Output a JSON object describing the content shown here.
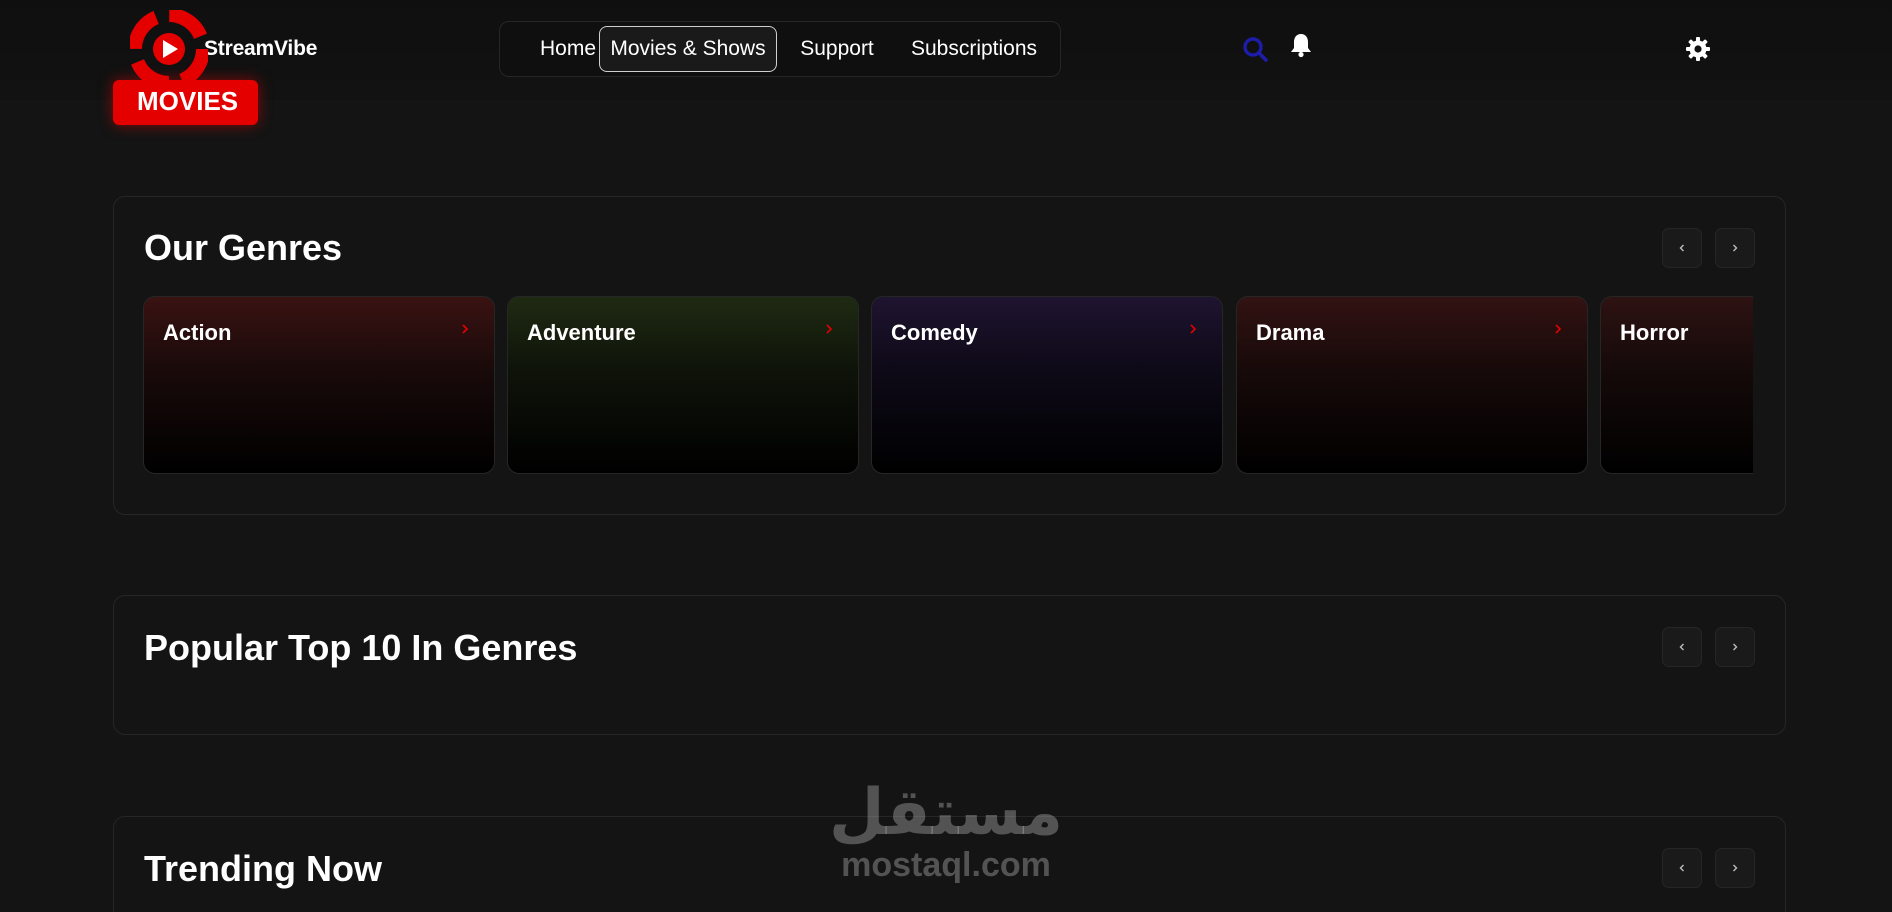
{
  "header": {
    "brand": "StreamVibe",
    "badge": "MOVIES",
    "nav": [
      {
        "label": "Home"
      },
      {
        "label": "Movies & Shows"
      },
      {
        "label": "Support"
      },
      {
        "label": "Subscriptions"
      }
    ],
    "active_nav": "Movies & Shows",
    "icons": [
      "search-icon",
      "bell-icon",
      "settings-icon"
    ]
  },
  "genres": {
    "title": "Our Genres",
    "items": [
      {
        "label": "Action",
        "tint": "#3a1212"
      },
      {
        "label": "Adventure",
        "tint": "#1f2a12"
      },
      {
        "label": "Comedy",
        "tint": "#1f1430"
      },
      {
        "label": "Drama",
        "tint": "#331212"
      },
      {
        "label": "Horror",
        "tint": "#2e1212"
      }
    ]
  },
  "popular": {
    "title": "Popular Top 10 In Genres"
  },
  "trending": {
    "title": "Trending Now"
  },
  "watermark": {
    "arabic": "مستقل",
    "latin": "mostaql.com"
  },
  "colors": {
    "accent": "#e50000",
    "background": "#141414",
    "border": "#262626",
    "search_icon": "#1d1daa"
  }
}
